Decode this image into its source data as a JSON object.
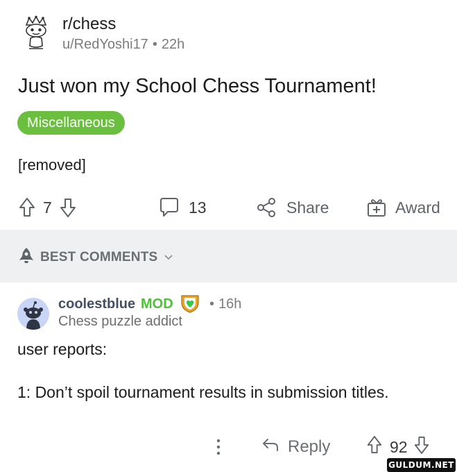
{
  "post": {
    "subreddit": "r/chess",
    "author": "u/RedYoshi17",
    "age": "22h",
    "title": "Just won my School Chess Tournament!",
    "flair": "Miscellaneous",
    "body": "[removed]",
    "score": "7",
    "comments_count": "13",
    "share_label": "Share",
    "award_label": "Award"
  },
  "sort": {
    "label": "BEST COMMENTS"
  },
  "comment": {
    "username": "coolestblue",
    "mod_label": "MOD",
    "age": "16h",
    "user_flair": "Chess puzzle addict",
    "line1": "user reports:",
    "line2": "1: Don’t spoil tournament results in submission titles.",
    "reply_label": "Reply",
    "score": "92"
  },
  "watermark": "GULDUM.NET",
  "colors": {
    "flair_bg": "#6abf3e",
    "mod_green": "#4fbf3c",
    "username": "#445063",
    "sort_bar_bg": "#eff0f1",
    "meta_gray": "#7c7c7c"
  },
  "icons": [
    "subreddit-icon",
    "upvote-icon",
    "downvote-icon",
    "comment-icon",
    "share-icon",
    "award-icon",
    "sort-rocket-icon",
    "chevron-down-icon",
    "avatar-icon",
    "mod-badge-icon",
    "more-icon",
    "reply-icon"
  ]
}
